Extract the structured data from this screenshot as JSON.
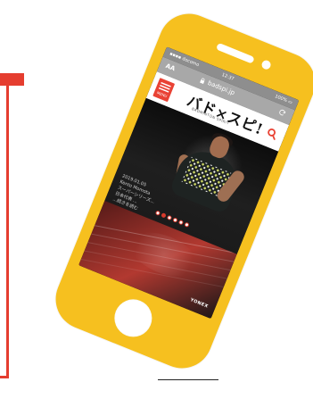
{
  "statusbar": {
    "carrier": "docomo",
    "time": "12:37",
    "battery": "100%"
  },
  "browser": {
    "aa": "AA",
    "url": "badspi.jp"
  },
  "site": {
    "menu_label": "MENU",
    "logo_title": "バド×スピ!",
    "logo_subtitle": "BADMINTON SPIRIT"
  },
  "hero": {
    "caption_lines": [
      "2019.01.05",
      "Kento Momota",
      "スーパーシリーズ...",
      "日本代表 ...",
      "...続きを読む"
    ],
    "active_slide": 2,
    "slide_count": 6
  },
  "banner": {
    "brand": "YONEX"
  },
  "colors": {
    "accent": "#E94234",
    "phone": "#F6C01F"
  }
}
